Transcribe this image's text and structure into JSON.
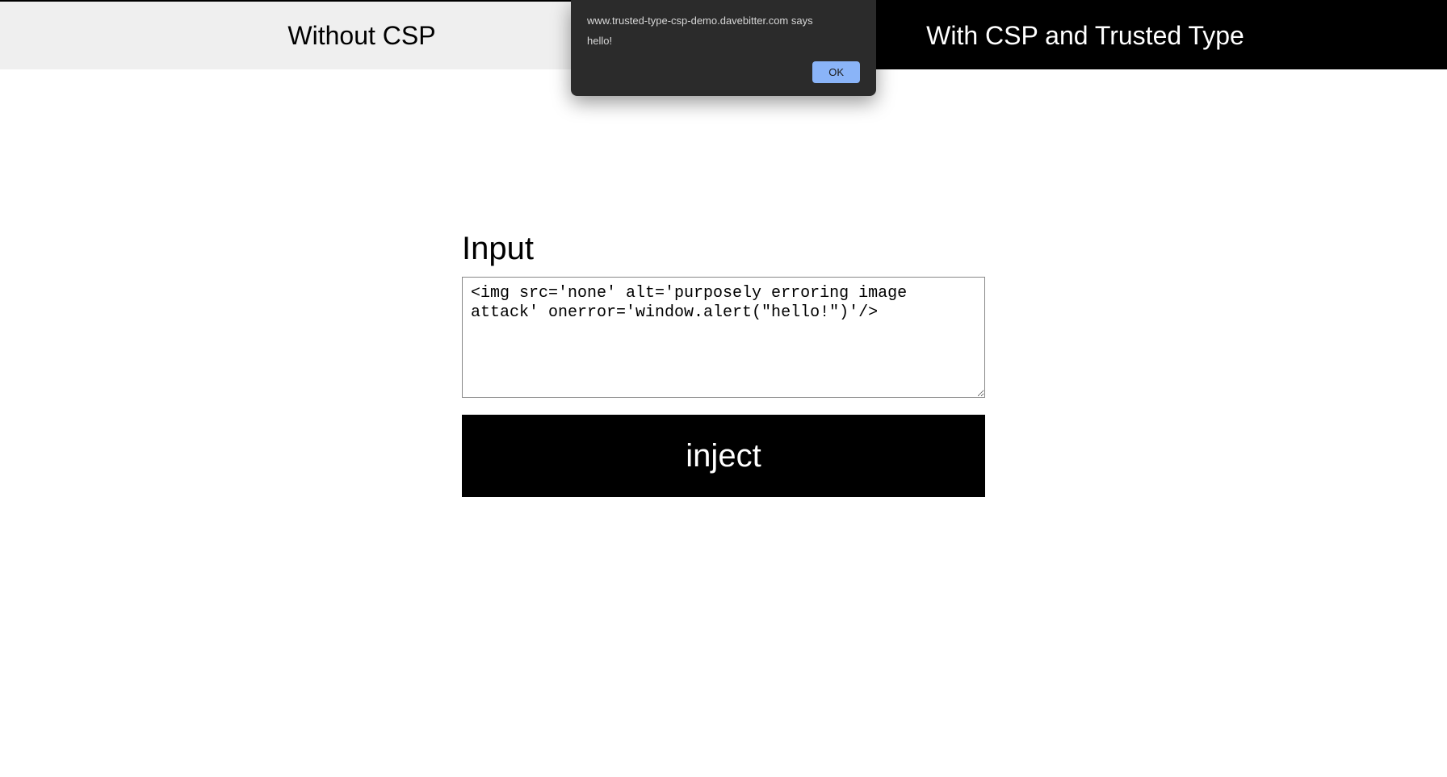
{
  "tabs": {
    "left": "Without CSP",
    "right": "With CSP and Trusted Type"
  },
  "form": {
    "heading": "Input",
    "textarea_value": "<img src='none' alt='purposely erroring image attack' onerror='window.alert(\"hello!\")'/>",
    "inject_label": "inject"
  },
  "alert": {
    "title": "www.trusted-type-csp-demo.davebitter.com says",
    "message": "hello!",
    "ok_label": "OK"
  }
}
